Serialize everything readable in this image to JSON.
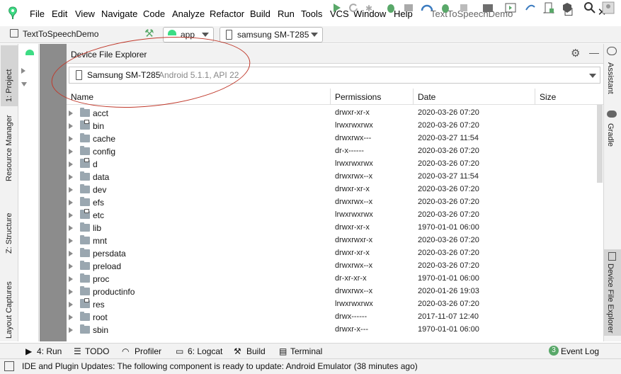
{
  "menu": [
    "File",
    "Edit",
    "View",
    "Navigate",
    "Code",
    "Analyze",
    "Refactor",
    "Build",
    "Run",
    "Tools",
    "VCS",
    "Window",
    "Help"
  ],
  "window_title": "TextToSpeechDemo",
  "toolbar": {
    "project_name": "TextToSpeechDemo",
    "run_config": "app",
    "device": "samsung SM-T285"
  },
  "left_stripe": [
    "1: Project",
    "Resource Manager",
    "Z: Structure",
    "Layout Captures"
  ],
  "right_stripe": [
    "Assistant",
    "Gradle",
    "Device File Explorer"
  ],
  "dfe": {
    "title": "Device File Explorer",
    "device_name": "Samsung SM-T285",
    "device_detail": "Android 5.1.1, API 22",
    "columns": [
      "Name",
      "Permissions",
      "Date",
      "Size"
    ],
    "rows": [
      {
        "name": "acct",
        "perm": "drwxr-xr-x",
        "date": "2020-03-26 07:20",
        "link": false
      },
      {
        "name": "bin",
        "perm": "lrwxrwxrwx",
        "date": "2020-03-26 07:20",
        "link": true
      },
      {
        "name": "cache",
        "perm": "drwxrwx---",
        "date": "2020-03-27 11:54",
        "link": false
      },
      {
        "name": "config",
        "perm": "dr-x------",
        "date": "2020-03-26 07:20",
        "link": false
      },
      {
        "name": "d",
        "perm": "lrwxrwxrwx",
        "date": "2020-03-26 07:20",
        "link": true
      },
      {
        "name": "data",
        "perm": "drwxrwx--x",
        "date": "2020-03-27 11:54",
        "link": false
      },
      {
        "name": "dev",
        "perm": "drwxr-xr-x",
        "date": "2020-03-26 07:20",
        "link": false
      },
      {
        "name": "efs",
        "perm": "drwxrwx--x",
        "date": "2020-03-26 07:20",
        "link": false
      },
      {
        "name": "etc",
        "perm": "lrwxrwxrwx",
        "date": "2020-03-26 07:20",
        "link": true
      },
      {
        "name": "lib",
        "perm": "drwxr-xr-x",
        "date": "1970-01-01 06:00",
        "link": false
      },
      {
        "name": "mnt",
        "perm": "drwxrwxr-x",
        "date": "2020-03-26 07:20",
        "link": false
      },
      {
        "name": "persdata",
        "perm": "drwxr-xr-x",
        "date": "2020-03-26 07:20",
        "link": false
      },
      {
        "name": "preload",
        "perm": "drwxrwx--x",
        "date": "2020-03-26 07:20",
        "link": false
      },
      {
        "name": "proc",
        "perm": "dr-xr-xr-x",
        "date": "1970-01-01 06:00",
        "link": false
      },
      {
        "name": "productinfo",
        "perm": "drwxrwx--x",
        "date": "2020-01-26 19:03",
        "link": false
      },
      {
        "name": "res",
        "perm": "lrwxrwxrwx",
        "date": "2020-03-26 07:20",
        "link": true
      },
      {
        "name": "root",
        "perm": "drwx------",
        "date": "2017-11-07 12:40",
        "link": false
      },
      {
        "name": "sbin",
        "perm": "drwxr-x---",
        "date": "1970-01-01 06:00",
        "link": false
      }
    ]
  },
  "bottom_tools": {
    "run": "4: Run",
    "todo": "TODO",
    "profiler": "Profiler",
    "logcat": "6: Logcat",
    "build": "Build",
    "terminal": "Terminal",
    "event_log_count": "3",
    "event_log": "Event Log"
  },
  "status": "IDE and Plugin Updates: The following component is ready to update: Android Emulator (38 minutes ago)",
  "colors": {
    "android_green": "#3ddc84",
    "run_green": "#59a869",
    "annotation_red": "#c0392b"
  }
}
